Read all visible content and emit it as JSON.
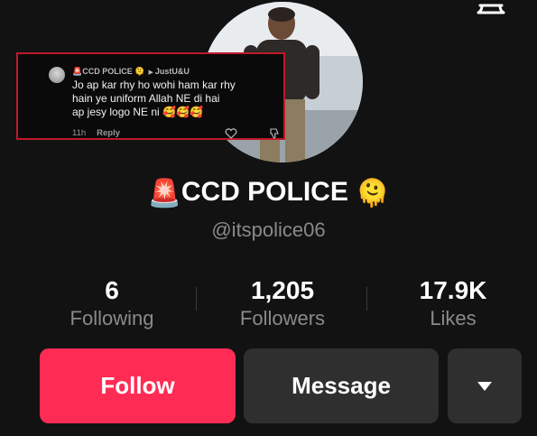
{
  "profile": {
    "name": "CCD POLICE",
    "handle": "@itspolice06"
  },
  "comment": {
    "author": "CCD POLICE",
    "reply_to": "JustU&U",
    "text_line1": "Jo ap kar rhy ho wohi ham kar rhy",
    "text_line2": "hain ye uniform Allah NE di hai",
    "text_line3": "ap jesy logo NE ni",
    "emojis": "🥰🥰🥰",
    "time": "11h",
    "reply_label": "Reply"
  },
  "stats": {
    "following_count": "6",
    "following_label": "Following",
    "followers_count": "1,205",
    "followers_label": "Followers",
    "likes_count": "17.9K",
    "likes_label": "Likes"
  },
  "buttons": {
    "follow_label": "Follow",
    "message_label": "Message"
  },
  "colors": {
    "follow": "#fe2c55",
    "highlight_border": "#c0182a",
    "background": "#121212"
  },
  "icons": [
    "bell-icon",
    "siren-icon",
    "smiling-face-emoji",
    "heart-icon",
    "dislike-icon",
    "dropdown-icon"
  ]
}
